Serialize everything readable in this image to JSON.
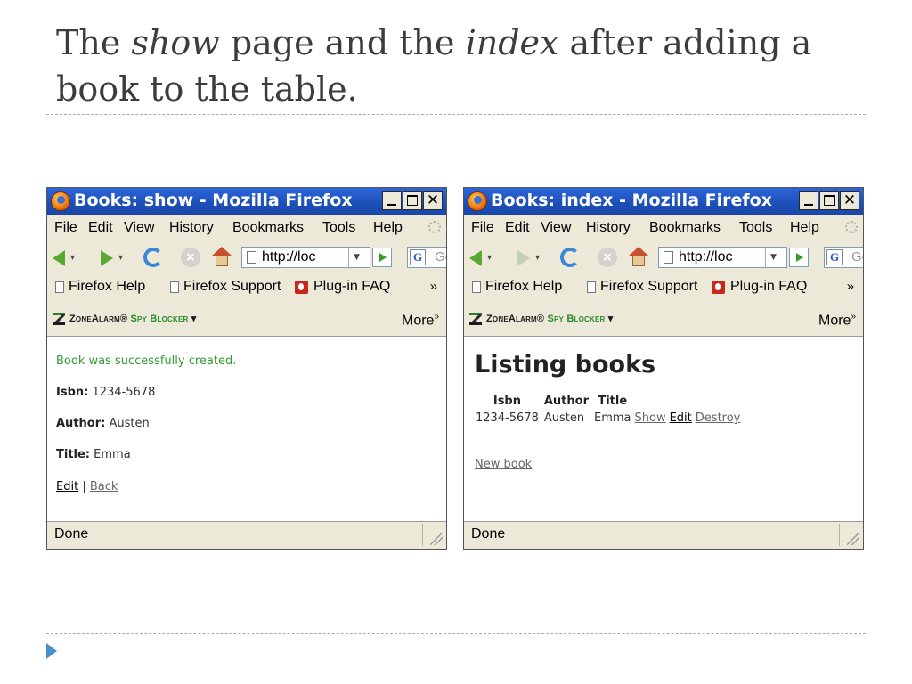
{
  "slide": {
    "title_part1": "The ",
    "title_show": "show",
    "title_part2": " page and the ",
    "title_index": "index",
    "title_part3": " after adding a book to the table."
  },
  "browser": {
    "menu": [
      "File",
      "Edit",
      "View",
      "History",
      "Bookmarks",
      "Tools",
      "Help"
    ],
    "url": "http://loc",
    "search_placeholder": "Goog",
    "bookmarks": [
      "Firefox Help",
      "Firefox Support",
      "Plug-in FAQ"
    ],
    "bookmarks_overflow": "»",
    "zonealarm_brand": "ZoneAlarm",
    "zonealarm_product": "Spy Blocker",
    "zonealarm_more": "More",
    "status": "Done"
  },
  "show_window": {
    "title": "Books: show - Mozilla Firefox",
    "flash": "Book was successfully created.",
    "isbn_label": "Isbn:",
    "isbn_value": "1234-5678",
    "author_label": "Author:",
    "author_value": "Austen",
    "title_label": "Title:",
    "title_value": "Emma",
    "edit_link": "Edit",
    "separator": "|",
    "back_link": "Back"
  },
  "index_window": {
    "title": "Books: index - Mozilla Firefox",
    "heading": "Listing books",
    "columns": [
      "Isbn",
      "Author",
      "Title"
    ],
    "rows": [
      {
        "isbn": "1234-5678",
        "author": "Austen",
        "title": "Emma",
        "show": "Show",
        "edit": "Edit",
        "destroy": "Destroy"
      }
    ],
    "new_link": "New book"
  }
}
